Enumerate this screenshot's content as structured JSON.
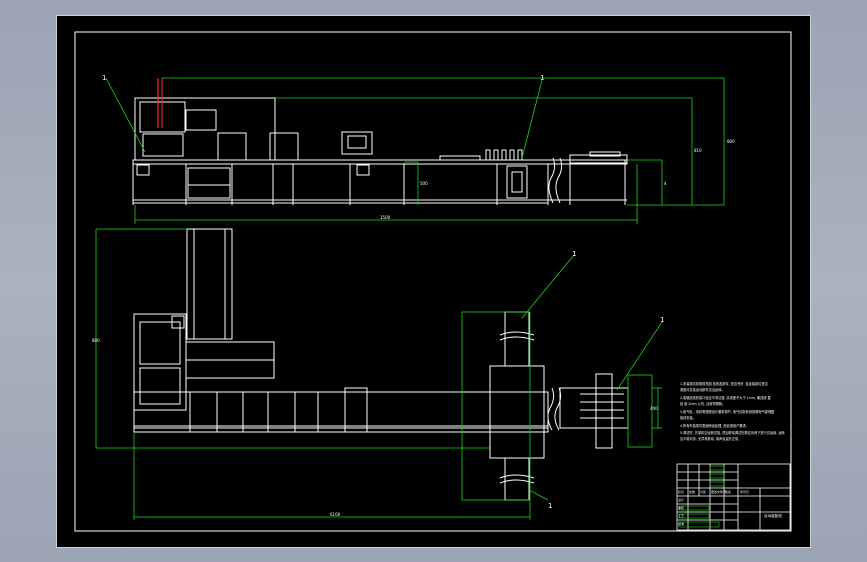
{
  "drawing": {
    "callouts": [
      "1",
      "1",
      "1",
      "1",
      "1"
    ],
    "dimensions": {
      "top_overall": "1500",
      "right_1": "800",
      "right_2": "810",
      "right_3": "4",
      "right_4": "500",
      "plan_height": "800",
      "plan_overall": "6100",
      "plan_right": "400"
    },
    "notes": [
      "1.安装调试前需按总图 检查各部件, 是否完好, 各连接部位是否",
      "紧固可靠各运动部件灵活运转。",
      "2.各输送线的接口处应平滑过渡, 高低差不大于 1mm, 输送线 直",
      "线 度 2mm 以内, 且转弯顺畅。",
      "3.各气缸、电机等按照设计要求调节, 电气控制系统按照电气原理图",
      "接线安装。",
      "4.所有外露零件表面喷涂处理, 颜色按用户要求。",
      "5.调试时, 先单机空运转试验, 然后联动调试在额定负荷下进行试运转, 运转",
      "应平稳可靠, 无异常振动, 噪声及温升正常。"
    ],
    "title_block": {
      "title": "自动装配线",
      "header_cells": [
        "标记",
        "处数",
        "分区",
        "更改文件号",
        "签名",
        "年月日"
      ],
      "row_labels": [
        "设计",
        "审核",
        "工艺",
        "批准"
      ]
    }
  }
}
